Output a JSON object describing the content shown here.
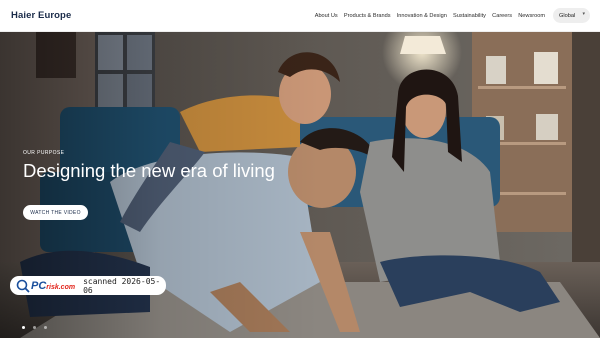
{
  "header": {
    "logo": "Haier Europe",
    "nav": [
      "About Us",
      "Products & Brands",
      "Innovation & Design",
      "Sustainability",
      "Careers",
      "Newsroom"
    ],
    "region": "Global"
  },
  "hero": {
    "eyebrow": "OUR PURPOSE",
    "headline": "Designing the new era of living",
    "cta": "WATCH THE VIDEO"
  },
  "watermark": {
    "brand_pc": "PC",
    "brand_risk": "risk.com",
    "text": "scanned 2026-05-06"
  },
  "colors": {
    "brand_navy": "#1a2b49",
    "region_pill": "#eeeeee",
    "accent_red": "#e2231a"
  }
}
